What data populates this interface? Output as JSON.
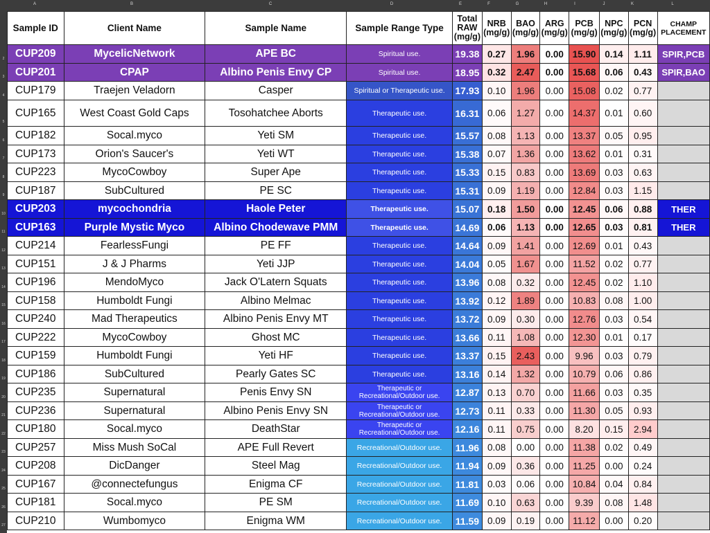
{
  "column_letters": [
    "A",
    "B",
    "C",
    "D",
    "E",
    "F",
    "G",
    "H",
    "I",
    "J",
    "K",
    "L"
  ],
  "headers": {
    "sample_id": "Sample ID",
    "client": "Client Name",
    "sample_name": "Sample Name",
    "range_type": "Sample Range Type",
    "total_raw": "Total RAW (mg/g)",
    "nrb": "NRB (mg/g)",
    "bao": "BAO (mg/g)",
    "arg": "ARG (mg/g)",
    "pcb": "PCB (mg/g)",
    "npc": "NPC (mg/g)",
    "pcn": "PCN (mg/g)",
    "champ": "CHAMP PLACEMENT"
  },
  "rows": [
    {
      "id": "CUP209",
      "client": "MycelicNetwork",
      "name": "APE BC",
      "range": "Spiritual use.",
      "raw": "19.38",
      "nrb": "0.27",
      "bao": "1.96",
      "arg": "0.00",
      "pcb": "15.90",
      "npc": "0.14",
      "pcn": "1.11",
      "champ": "SPIR,PCB",
      "hl": "purple"
    },
    {
      "id": "CUP201",
      "client": "CPAP",
      "name": "Albino Penis Envy CP",
      "range": "Spiritual use.",
      "raw": "18.95",
      "nrb": "0.32",
      "bao": "2.47",
      "arg": "0.00",
      "pcb": "15.68",
      "npc": "0.06",
      "pcn": "0.43",
      "champ": "SPIR,BAO",
      "hl": "purple"
    },
    {
      "id": "CUP179",
      "client": "Traejen Veladorn",
      "name": "Casper",
      "range": "Spiritual or Therapeutic use.",
      "raw": "17.93",
      "nrb": "0.10",
      "bao": "1.96",
      "arg": "0.00",
      "pcb": "15.08",
      "npc": "0.02",
      "pcn": "0.77",
      "champ": "",
      "hl": ""
    },
    {
      "id": "CUP165",
      "client": "West Coast Gold Caps",
      "name": "Tosohatchee Aborts",
      "range": "Therapeutic use.",
      "raw": "16.31",
      "nrb": "0.06",
      "bao": "1.27",
      "arg": "0.00",
      "pcb": "14.37",
      "npc": "0.01",
      "pcn": "0.60",
      "champ": "",
      "hl": ""
    },
    {
      "id": "CUP182",
      "client": "Socal.myco",
      "name": "Yeti SM",
      "range": "Therapeutic use.",
      "raw": "15.57",
      "nrb": "0.08",
      "bao": "1.13",
      "arg": "0.00",
      "pcb": "13.37",
      "npc": "0.05",
      "pcn": "0.95",
      "champ": "",
      "hl": ""
    },
    {
      "id": "CUP173",
      "client": "Orion's Saucer's",
      "name": "Yeti WT",
      "range": "Therapeutic use.",
      "raw": "15.38",
      "nrb": "0.07",
      "bao": "1.36",
      "arg": "0.00",
      "pcb": "13.62",
      "npc": "0.01",
      "pcn": "0.31",
      "champ": "",
      "hl": ""
    },
    {
      "id": "CUP223",
      "client": "MycoCowboy",
      "name": "Super Ape",
      "range": "Therapeutic use.",
      "raw": "15.33",
      "nrb": "0.15",
      "bao": "0.83",
      "arg": "0.00",
      "pcb": "13.69",
      "npc": "0.03",
      "pcn": "0.63",
      "champ": "",
      "hl": ""
    },
    {
      "id": "CUP187",
      "client": "SubCultured",
      "name": "PE SC",
      "range": "Therapeutic use.",
      "raw": "15.31",
      "nrb": "0.09",
      "bao": "1.19",
      "arg": "0.00",
      "pcb": "12.84",
      "npc": "0.03",
      "pcn": "1.15",
      "champ": "",
      "hl": ""
    },
    {
      "id": "CUP203",
      "client": "mycochondria",
      "name": "Haole Peter",
      "range": "Therapeutic use.",
      "raw": "15.07",
      "nrb": "0.18",
      "bao": "1.50",
      "arg": "0.00",
      "pcb": "12.45",
      "npc": "0.06",
      "pcn": "0.88",
      "champ": "THER",
      "hl": "blue"
    },
    {
      "id": "CUP163",
      "client": "Purple Mystic Myco",
      "name": "Albino Chodewave PMM",
      "range": "Therapeutic use.",
      "raw": "14.69",
      "nrb": "0.06",
      "bao": "1.13",
      "arg": "0.00",
      "pcb": "12.65",
      "npc": "0.03",
      "pcn": "0.81",
      "champ": "THER",
      "hl": "blue"
    },
    {
      "id": "CUP214",
      "client": "FearlessFungi",
      "name": "PE FF",
      "range": "Therapeutic use.",
      "raw": "14.64",
      "nrb": "0.09",
      "bao": "1.41",
      "arg": "0.00",
      "pcb": "12.69",
      "npc": "0.01",
      "pcn": "0.43",
      "champ": "",
      "hl": ""
    },
    {
      "id": "CUP151",
      "client": "J & J Pharms",
      "name": "Yeti JJP",
      "range": "Therapeutic use.",
      "raw": "14.04",
      "nrb": "0.05",
      "bao": "1.67",
      "arg": "0.00",
      "pcb": "11.52",
      "npc": "0.02",
      "pcn": "0.77",
      "champ": "",
      "hl": ""
    },
    {
      "id": "CUP196",
      "client": "MendoMyco",
      "name": "Jack O'Latern Squats",
      "range": "Therapeutic use.",
      "raw": "13.96",
      "nrb": "0.08",
      "bao": "0.32",
      "arg": "0.00",
      "pcb": "12.45",
      "npc": "0.02",
      "pcn": "1.10",
      "champ": "",
      "hl": ""
    },
    {
      "id": "CUP158",
      "client": "Humboldt Fungi",
      "name": "Albino Melmac",
      "range": "Therapeutic use.",
      "raw": "13.92",
      "nrb": "0.12",
      "bao": "1.89",
      "arg": "0.00",
      "pcb": "10.83",
      "npc": "0.08",
      "pcn": "1.00",
      "champ": "",
      "hl": ""
    },
    {
      "id": "CUP240",
      "client": "Mad Therapeutics",
      "name": "Albino Penis Envy MT",
      "range": "Therapeutic use.",
      "raw": "13.72",
      "nrb": "0.09",
      "bao": "0.30",
      "arg": "0.00",
      "pcb": "12.76",
      "npc": "0.03",
      "pcn": "0.54",
      "champ": "",
      "hl": ""
    },
    {
      "id": "CUP222",
      "client": "MycoCowboy",
      "name": "Ghost MC",
      "range": "Therapeutic use.",
      "raw": "13.66",
      "nrb": "0.11",
      "bao": "1.08",
      "arg": "0.00",
      "pcb": "12.30",
      "npc": "0.01",
      "pcn": "0.17",
      "champ": "",
      "hl": ""
    },
    {
      "id": "CUP159",
      "client": "Humboldt Fungi",
      "name": "Yeti HF",
      "range": "Therapeutic use.",
      "raw": "13.37",
      "nrb": "0.15",
      "bao": "2.43",
      "arg": "0.00",
      "pcb": "9.96",
      "npc": "0.03",
      "pcn": "0.79",
      "champ": "",
      "hl": ""
    },
    {
      "id": "CUP186",
      "client": "SubCultured",
      "name": "Pearly Gates SC",
      "range": "Therapeutic use.",
      "raw": "13.16",
      "nrb": "0.14",
      "bao": "1.32",
      "arg": "0.00",
      "pcb": "10.79",
      "npc": "0.06",
      "pcn": "0.86",
      "champ": "",
      "hl": ""
    },
    {
      "id": "CUP235",
      "client": "Supernatural",
      "name": "Penis Envy SN",
      "range": "Therapeutic or Recreational/Outdoor use.",
      "raw": "12.87",
      "nrb": "0.13",
      "bao": "0.70",
      "arg": "0.00",
      "pcb": "11.66",
      "npc": "0.03",
      "pcn": "0.35",
      "champ": "",
      "hl": ""
    },
    {
      "id": "CUP236",
      "client": "Supernatural",
      "name": "Albino Penis Envy SN",
      "range": "Therapeutic or Recreational/Outdoor use.",
      "raw": "12.73",
      "nrb": "0.11",
      "bao": "0.33",
      "arg": "0.00",
      "pcb": "11.30",
      "npc": "0.05",
      "pcn": "0.93",
      "champ": "",
      "hl": ""
    },
    {
      "id": "CUP180",
      "client": "Socal.myco",
      "name": "DeathStar",
      "range": "Therapeutic or Recreational/Outdoor use.",
      "raw": "12.16",
      "nrb": "0.11",
      "bao": "0.75",
      "arg": "0.00",
      "pcb": "8.20",
      "npc": "0.15",
      "pcn": "2.94",
      "champ": "",
      "hl": ""
    },
    {
      "id": "CUP257",
      "client": "Miss Mush SoCal",
      "name": "APE Full Revert",
      "range": "Recreational/Outdoor use.",
      "raw": "11.96",
      "nrb": "0.08",
      "bao": "0.00",
      "arg": "0.00",
      "pcb": "11.38",
      "npc": "0.02",
      "pcn": "0.49",
      "champ": "",
      "hl": ""
    },
    {
      "id": "CUP208",
      "client": "DicDanger",
      "name": "Steel Mag",
      "range": "Recreational/Outdoor use.",
      "raw": "11.94",
      "nrb": "0.09",
      "bao": "0.36",
      "arg": "0.00",
      "pcb": "11.25",
      "npc": "0.00",
      "pcn": "0.24",
      "champ": "",
      "hl": ""
    },
    {
      "id": "CUP167",
      "client": "@connectefungus",
      "name": "Enigma CF",
      "range": "Recreational/Outdoor use.",
      "raw": "11.81",
      "nrb": "0.03",
      "bao": "0.06",
      "arg": "0.00",
      "pcb": "10.84",
      "npc": "0.04",
      "pcn": "0.84",
      "champ": "",
      "hl": ""
    },
    {
      "id": "CUP181",
      "client": "Socal.myco",
      "name": "PE SM",
      "range": "Recreational/Outdoor use.",
      "raw": "11.69",
      "nrb": "0.10",
      "bao": "0.63",
      "arg": "0.00",
      "pcb": "9.39",
      "npc": "0.08",
      "pcn": "1.48",
      "champ": "",
      "hl": ""
    },
    {
      "id": "CUP210",
      "client": "Wumbomyco",
      "name": "Enigma WM",
      "range": "Recreational/Outdoor use.",
      "raw": "11.59",
      "nrb": "0.09",
      "bao": "0.19",
      "arg": "0.00",
      "pcb": "11.12",
      "npc": "0.00",
      "pcn": "0.20",
      "champ": "",
      "hl": ""
    }
  ],
  "colors": {
    "purple_highlight": "#7b3fb5",
    "blue_highlight": "#1515d6",
    "spiritual_or_therapeutic": "#3555c8",
    "therapeutic": "#2b3fe0",
    "therapeutic_or_recreational": "#3a44f0",
    "recreational": "#3aa6e6",
    "champ_empty": "#d9d9d9",
    "heat_red": "#e8504f"
  }
}
